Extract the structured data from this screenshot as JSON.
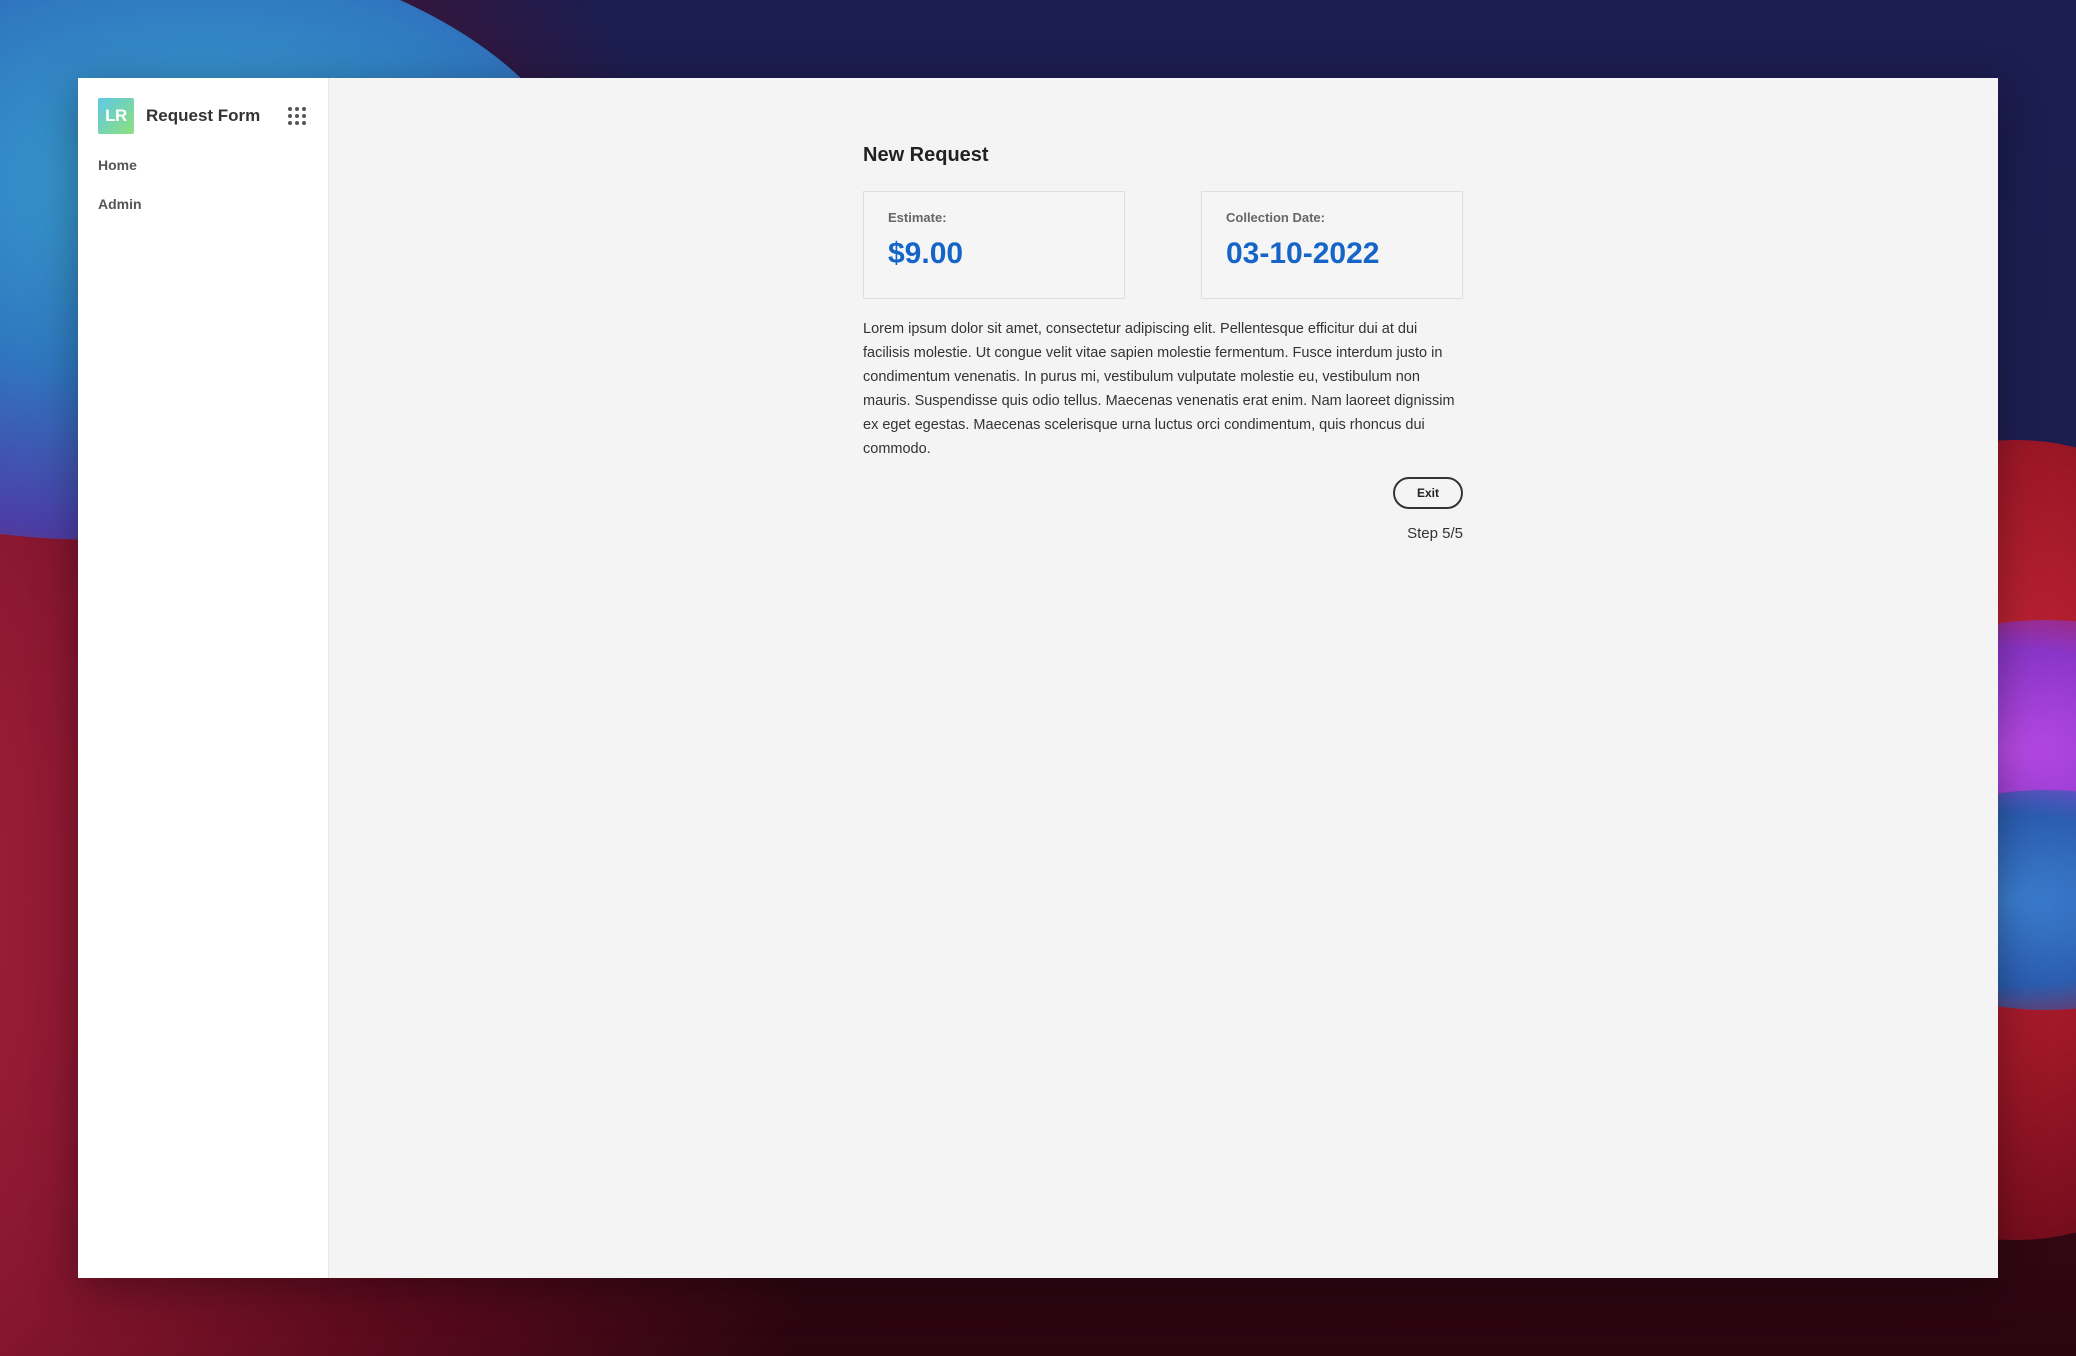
{
  "app": {
    "logo_text": "LR",
    "title": "Request Form"
  },
  "sidebar": {
    "items": [
      {
        "label": "Home"
      },
      {
        "label": "Admin"
      }
    ]
  },
  "main": {
    "page_title": "New Request",
    "cards": [
      {
        "label": "Estimate:",
        "value": "$9.00"
      },
      {
        "label": "Collection Date:",
        "value": "03-10-2022"
      }
    ],
    "body_text": "Lorem ipsum dolor sit amet, consectetur adipiscing elit. Pellentesque efficitur dui at dui facilisis molestie. Ut congue velit vitae sapien molestie fermentum. Fusce interdum justo in condimentum venenatis. In purus mi, vestibulum vulputate molestie eu, vestibulum non mauris. Suspendisse quis odio tellus. Maecenas venenatis erat enim. Nam laoreet dignissim ex eget egestas. Maecenas scelerisque urna luctus orci condimentum, quis rhoncus dui commodo.",
    "exit_label": "Exit",
    "step_label": "Step 5/5"
  },
  "colors": {
    "accent_value": "#1565c8",
    "window_bg": "#f4f4f4",
    "sidebar_bg": "#ffffff"
  },
  "icons": {
    "apps": "grid-apps-icon"
  }
}
